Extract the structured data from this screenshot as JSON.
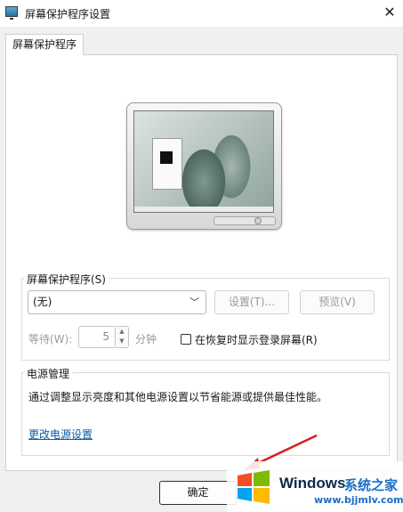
{
  "window": {
    "title": "屏幕保护程序设置",
    "close_glyph": "✕"
  },
  "tabs": [
    {
      "label": "屏幕保护程序"
    }
  ],
  "screensaver_group": {
    "label": "屏幕保护程序(S)",
    "selected_value": "(无)",
    "settings_button": "设置(T)...",
    "preview_button": "预览(V)",
    "wait_label": "等待(W):",
    "wait_value": "5",
    "minutes_label": "分钟",
    "resume_checkbox_label": "在恢复时显示登录屏幕(R)",
    "resume_checked": false
  },
  "power_group": {
    "label": "电源管理",
    "description": "通过调整显示亮度和其他电源设置以节省能源或提供最佳性能。",
    "link": "更改电源设置"
  },
  "footer": {
    "ok_button": "确定"
  },
  "watermark": {
    "brand": "Windows",
    "site_name": "系统之家",
    "url": "www.bjjmlv.com"
  },
  "colors": {
    "link": "#0a5aa8",
    "arrow": "#d42020"
  }
}
